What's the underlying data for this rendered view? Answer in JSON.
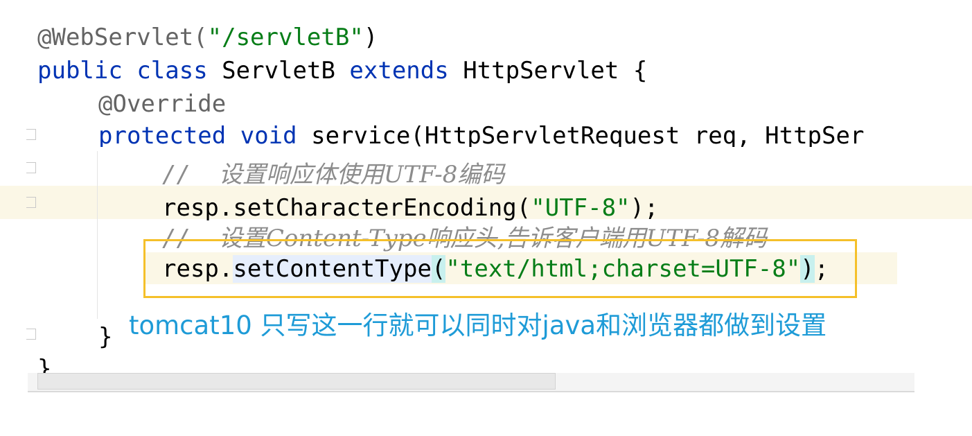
{
  "code": {
    "line1": {
      "annotation": "@WebServlet(",
      "string": "\"/servletB\"",
      "close": ")"
    },
    "line2": {
      "kw1": "public",
      "kw2": "class",
      "name": "ServletB",
      "kw3": "extends",
      "parent": "HttpServlet {"
    },
    "line3": {
      "annotation": "@Override"
    },
    "line4": {
      "kw1": "protected",
      "kw2": "void",
      "rest": "service(HttpServletRequest req, HttpSer"
    },
    "line5": {
      "slashes": "//",
      "comment": "设置响应体使用UTF-8编码"
    },
    "line6": {
      "prefix": "resp.setCharacterEncoding(",
      "string": "\"UTF-8\"",
      "suffix": ");"
    },
    "line7": {
      "slashes": "//",
      "comment": "设置Content-Type响应头,告诉客户端用UTF-8解码"
    },
    "line8": {
      "obj": "resp.",
      "method": "setContentType",
      "open": "(",
      "string": "\"text/html;charset=UTF-8\"",
      "close": ")",
      "semi": ";"
    },
    "line9": {
      "brace": "}"
    },
    "line10": {
      "brace": "}"
    }
  },
  "caption": "tomcat10 只写这一行就可以同时对java和浏览器都做到设置",
  "colors": {
    "highlight_box": "#f5c02a",
    "caption": "#1e9bd7",
    "keyword": "#0033b3",
    "string": "#067d17"
  }
}
